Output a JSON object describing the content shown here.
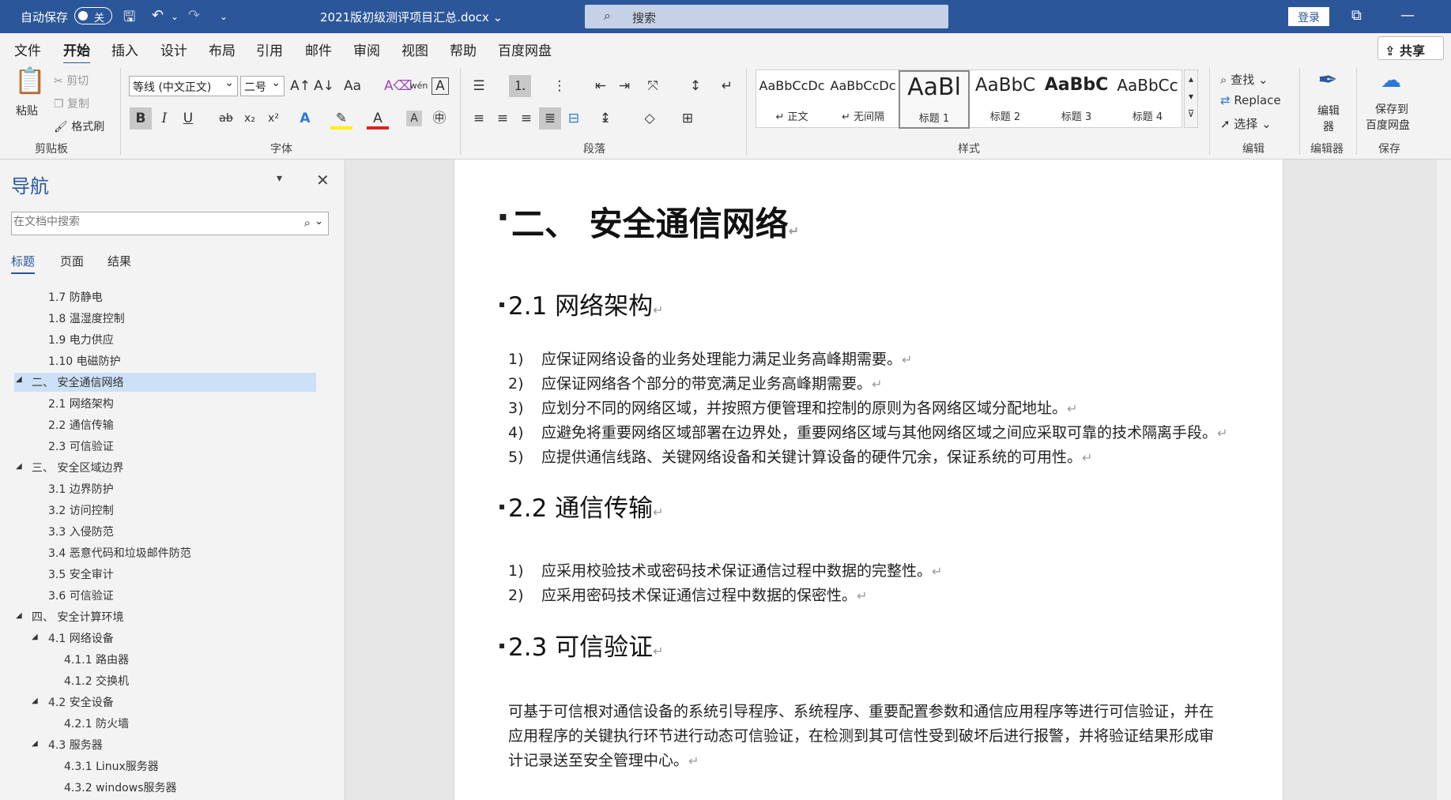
{
  "titlebar": {
    "autosave": "自动保存",
    "toggle": "关",
    "doc_title": "2021版初级测评项目汇总.docx ⌄",
    "search": "搜索",
    "login": "登录"
  },
  "tabs": [
    "文件",
    "开始",
    "插入",
    "设计",
    "布局",
    "引用",
    "邮件",
    "审阅",
    "视图",
    "帮助",
    "百度网盘"
  ],
  "share": "共享",
  "ribbon": {
    "clipboard": {
      "paste": "粘贴",
      "cut": "剪切",
      "copy": "复制",
      "format_painter": "格式刷",
      "label": "剪贴板"
    },
    "font": {
      "family": "等线 (中文正文)",
      "size": "二号",
      "label": "字体"
    },
    "paragraph": {
      "label": "段落"
    },
    "styles": {
      "items": [
        {
          "sample": "AaBbCcDc",
          "name": "↵ 正文"
        },
        {
          "sample": "AaBbCcDc",
          "name": "↵ 无间隔"
        },
        {
          "sample": "AaBl",
          "name": "标题 1"
        },
        {
          "sample": "AaBbC",
          "name": "标题 2"
        },
        {
          "sample": "AaBbC",
          "name": "标题 3"
        },
        {
          "sample": "AaBbCc",
          "name": "标题 4"
        }
      ],
      "label": "样式"
    },
    "editing": {
      "find": "查找",
      "replace": "Replace",
      "select": "选择",
      "label": "编辑"
    },
    "editor": {
      "btn": "编辑器",
      "label": "编辑器"
    },
    "save": {
      "btn1": "保存到",
      "btn2": "百度网盘",
      "label": "保存"
    }
  },
  "nav": {
    "title": "导航",
    "search_placeholder": "在文档中搜索",
    "tabs": [
      "标题",
      "页面",
      "结果"
    ],
    "tree": [
      "1.7 防静电",
      "1.8 温湿度控制",
      "1.9 电力供应",
      "1.10 电磁防护",
      "二、 安全通信网络",
      "2.1 网络架构",
      "2.2 通信传输",
      "2.3 可信验证",
      "三、 安全区域边界",
      "3.1 边界防护",
      "3.2 访问控制",
      "3.3 入侵防范",
      "3.4 恶意代码和垃圾邮件防范",
      "3.5 安全审计",
      "3.6 可信验证",
      "四、 安全计算环境",
      "4.1 网络设备",
      "4.1.1 路由器",
      "4.1.2 交换机",
      "4.2 安全设备",
      "4.2.1 防火墙",
      "4.3 服务器",
      "4.3.1 Linux服务器",
      "4.3.2 windows服务器"
    ]
  },
  "doc": {
    "h1": "二、    安全通信网络",
    "s21": "2.1    网络架构",
    "s21_items": [
      [
        "1)",
        "应保证网络设备的业务处理能力满足业务高峰期需要。"
      ],
      [
        "2)",
        "应保证网络各个部分的带宽满足业务高峰期需要。"
      ],
      [
        "3)",
        "应划分不同的网络区域，并按照方便管理和控制的原则为各网络区域分配地址。"
      ],
      [
        "4)",
        "应避免将重要网络区域部署在边界处，重要网络区域与其他网络区域之间应采取可靠的技术隔离手段。"
      ],
      [
        "5)",
        "应提供通信线路、关键网络设备和关键计算设备的硬件冗余，保证系统的可用性。"
      ]
    ],
    "s22": "2.2    通信传输",
    "s22_items": [
      [
        "1)",
        "应采用校验技术或密码技术保证通信过程中数据的完整性。"
      ],
      [
        "2)",
        "应采用密码技术保证通信过程中数据的保密性。"
      ]
    ],
    "s23": "2.3    可信验证",
    "para": "可基于可信根对通信设备的系统引导程序、系统程序、重要配置参数和通信应用程序等进行可信验证，并在应用程序的关键执行环节进行动态可信验证，在检测到其可信性受到破坏后进行报警，并将验证结果形成审计记录送至安全管理中心。"
  },
  "colors": {
    "accent": "#2b579a",
    "selection": "#cce0f7"
  }
}
